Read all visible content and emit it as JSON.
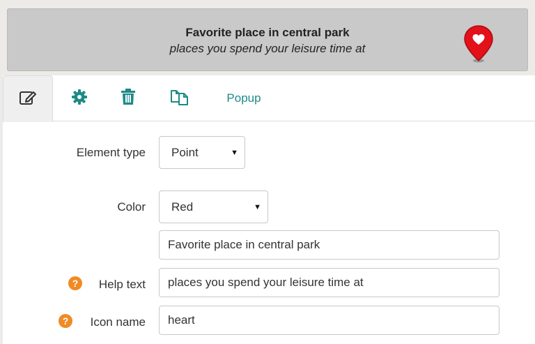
{
  "header": {
    "title": "Favorite place in central park",
    "subtitle": "places you spend your leisure time at",
    "marker_color": "#e3111a"
  },
  "tabs": [
    {
      "icon": "edit-icon",
      "active": true
    },
    {
      "icon": "gear-icon",
      "active": false
    },
    {
      "icon": "trash-icon",
      "active": false
    },
    {
      "icon": "copy-icon",
      "active": false
    },
    {
      "label": "Popup",
      "active": false
    }
  ],
  "form": {
    "element_type": {
      "label": "Element type",
      "value": "Point"
    },
    "color": {
      "label": "Color",
      "value": "Red"
    },
    "title_value": "Favorite place in central park",
    "help_text": {
      "label": "Help text",
      "value": "places you spend your leisure time at"
    },
    "icon_name": {
      "label": "Icon name",
      "value": "heart"
    }
  },
  "colors": {
    "accent": "#1d8a87",
    "help": "#f08a24"
  }
}
